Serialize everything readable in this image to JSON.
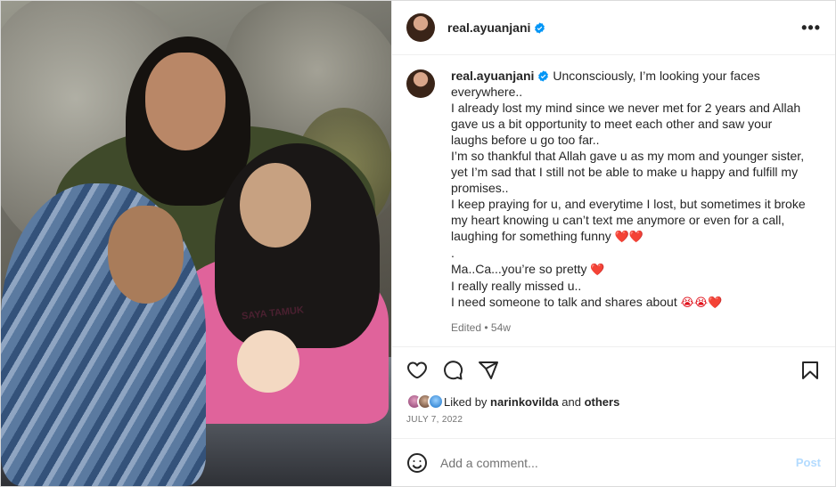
{
  "header": {
    "username": "real.ayuanjani",
    "more_label": "•••"
  },
  "photo": {
    "shirt_print": "SAYA TAMUK"
  },
  "caption": {
    "username": "real.ayuanjani",
    "lines": [
      "Unconsciously, I’m looking your faces",
      "everywhere..",
      "I already lost my mind since we never met for 2 years and Allah",
      "gave us a bit opportunity to meet each other and saw your",
      "laughs before u go too far..",
      "I’m so thankful that Allah gave u as my mom and younger sister,",
      "yet I’m sad that I still not be able to make u happy and fulfill my",
      "promises..",
      "I keep praying for u, and everytime I lost, but sometimes it broke",
      "my heart knowing u can’t text me anymore or even for a call,",
      "laughing for something funny",
      ".",
      "Ma..Ca...you’re so pretty",
      "I really really missed u..",
      "I need someone to talk and shares about"
    ],
    "emoji": {
      "hearts_line11": "❤️❤️",
      "heart_line13": "❤️",
      "line15": "😭😭❤️"
    },
    "edited": "Edited • 54w"
  },
  "likes": {
    "prefix": "Liked by",
    "user": "narinkovilda",
    "connector": "and",
    "others": "others"
  },
  "date": "JULY 7, 2022",
  "comment": {
    "placeholder": "Add a comment...",
    "post_label": "Post"
  },
  "colors": {
    "verified": "#0095f6",
    "heart": "#e0121c",
    "post_disabled": "#b3dbff"
  }
}
